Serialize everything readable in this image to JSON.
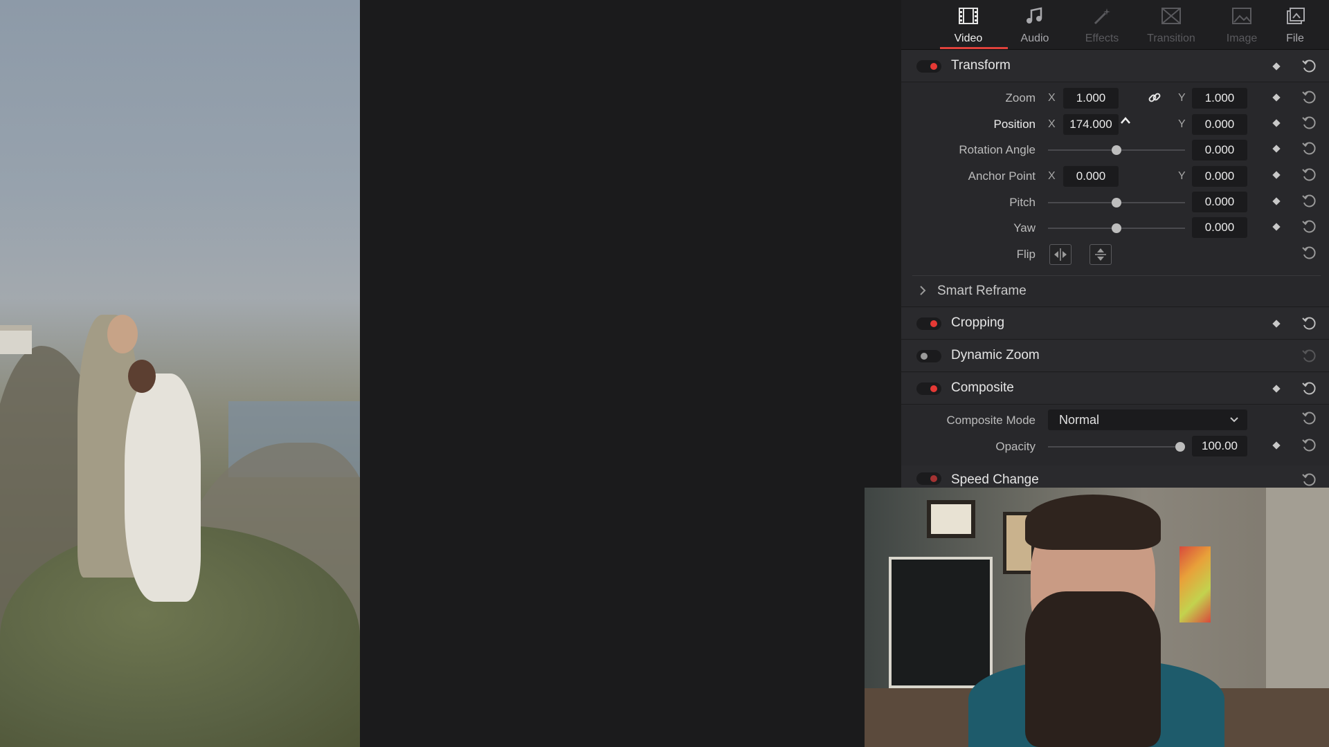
{
  "tabs": [
    {
      "label": "Video",
      "icon": "video-icon",
      "state": "active"
    },
    {
      "label": "Audio",
      "icon": "audio-icon",
      "state": "mid"
    },
    {
      "label": "Effects",
      "icon": "effects-icon",
      "state": "dim"
    },
    {
      "label": "Transition",
      "icon": "transition-icon",
      "state": "dim"
    },
    {
      "label": "Image",
      "icon": "image-icon",
      "state": "dim"
    },
    {
      "label": "File",
      "icon": "file-icon",
      "state": "mid"
    }
  ],
  "transform": {
    "title": "Transform",
    "zoom": {
      "label": "Zoom",
      "x_axis": "X",
      "x": "1.000",
      "y_axis": "Y",
      "y": "1.000"
    },
    "position": {
      "label": "Position",
      "x_axis": "X",
      "x": "174.000",
      "y_axis": "Y",
      "y": "0.000"
    },
    "rotation": {
      "label": "Rotation Angle",
      "value": "0.000",
      "slider_fraction": 0.5
    },
    "anchor": {
      "label": "Anchor Point",
      "x_axis": "X",
      "x": "0.000",
      "y_axis": "Y",
      "y": "0.000"
    },
    "pitch": {
      "label": "Pitch",
      "value": "0.000",
      "slider_fraction": 0.5
    },
    "yaw": {
      "label": "Yaw",
      "value": "0.000",
      "slider_fraction": 0.5
    },
    "flip": {
      "label": "Flip"
    }
  },
  "smart_reframe": {
    "title": "Smart Reframe"
  },
  "cropping": {
    "title": "Cropping"
  },
  "dynamic_zoom": {
    "title": "Dynamic Zoom"
  },
  "composite": {
    "title": "Composite",
    "mode_label": "Composite Mode",
    "mode_value": "Normal",
    "opacity_label": "Opacity",
    "opacity_value": "100.00",
    "opacity_fraction": 1.0
  },
  "speed_change": {
    "title": "Speed Change"
  },
  "colors": {
    "accent": "#e0423c",
    "panel": "#28282b",
    "field": "#1b1b1d"
  }
}
